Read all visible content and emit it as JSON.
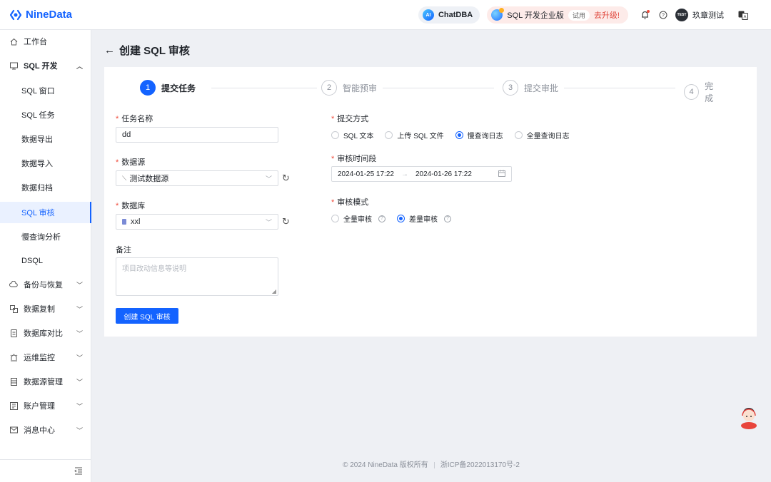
{
  "header": {
    "brand": "NineData",
    "chatdba_label": "ChatDBA",
    "ai_badge": "AI",
    "edition_label": "SQL 开发企业版",
    "trial_label": "试用",
    "upgrade_label": "去升级!",
    "user_avatar_text": "TEST",
    "user_name": "玖章测试"
  },
  "sidebar": {
    "workbench": "工作台",
    "sql_dev": "SQL 开发",
    "sub_items": [
      "SQL 窗口",
      "SQL 任务",
      "数据导出",
      "数据导入",
      "数据归档",
      "SQL 审核",
      "慢查询分析",
      "DSQL"
    ],
    "groups": [
      "备份与恢复",
      "数据复制",
      "数据库对比",
      "运维监控",
      "数据源管理",
      "账户管理",
      "消息中心"
    ]
  },
  "page": {
    "title": "创建 SQL 审核"
  },
  "steps": [
    {
      "num": "1",
      "label": "提交任务"
    },
    {
      "num": "2",
      "label": "智能预审"
    },
    {
      "num": "3",
      "label": "提交审批"
    },
    {
      "num": "4",
      "label": "完成"
    }
  ],
  "form": {
    "task_name_label": "任务名称",
    "task_name_value": "dd",
    "datasource_label": "数据源",
    "datasource_value": "测试数据源",
    "database_label": "数据库",
    "database_value": "xxl",
    "remark_label": "备注",
    "remark_placeholder": "项目改动信息等说明",
    "submit_button": "创建 SQL 审核",
    "submit_mode_label": "提交方式",
    "submit_modes": [
      "SQL 文本",
      "上传 SQL 文件",
      "慢查询日志",
      "全量查询日志"
    ],
    "submit_mode_selected": "慢查询日志",
    "time_range_label": "审核时间段",
    "time_start": "2024-01-25 17:22",
    "time_end": "2024-01-26 17:22",
    "audit_mode_label": "审核模式",
    "audit_modes": [
      "全量审核",
      "差量审核"
    ],
    "audit_mode_selected": "差量审核"
  },
  "footer": {
    "copyright": "© 2024 NineData 版权所有",
    "icp": "浙ICP备2022013170号-2"
  },
  "colors": {
    "primary": "#1463ff",
    "required": "#f04a3a"
  }
}
